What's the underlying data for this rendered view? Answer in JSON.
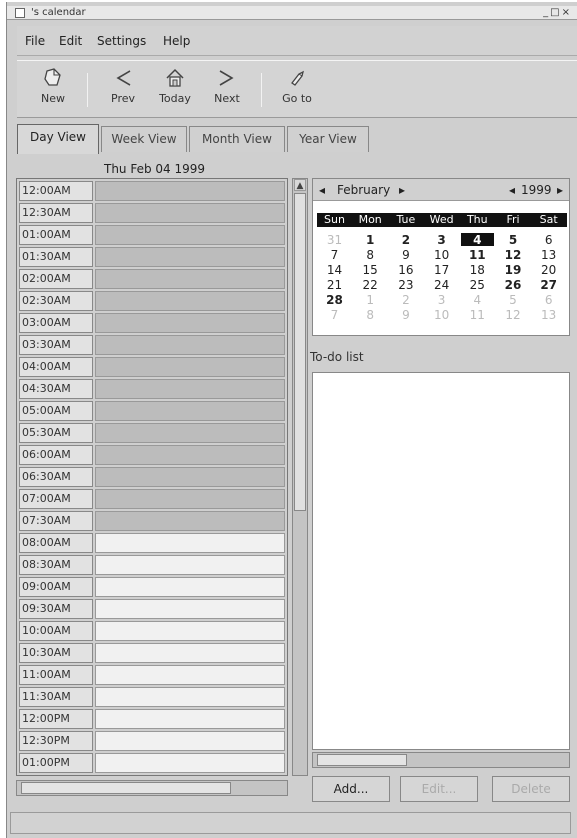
{
  "window": {
    "title": "'s calendar",
    "controls": "_□×"
  },
  "menu": {
    "file": "File",
    "edit": "Edit",
    "settings": "Settings",
    "help": "Help"
  },
  "toolbar": {
    "new": "New",
    "prev": "Prev",
    "today": "Today",
    "next": "Next",
    "goto": "Go to"
  },
  "tabs": {
    "day": "Day View",
    "week": "Week View",
    "month": "Month View",
    "year": "Year View",
    "active": "day"
  },
  "day_view": {
    "date": "Thu Feb 04 1999",
    "rows": [
      {
        "time": "12:00AM",
        "work": false
      },
      {
        "time": "12:30AM",
        "work": false
      },
      {
        "time": "01:00AM",
        "work": false
      },
      {
        "time": "01:30AM",
        "work": false
      },
      {
        "time": "02:00AM",
        "work": false
      },
      {
        "time": "02:30AM",
        "work": false
      },
      {
        "time": "03:00AM",
        "work": false
      },
      {
        "time": "03:30AM",
        "work": false
      },
      {
        "time": "04:00AM",
        "work": false
      },
      {
        "time": "04:30AM",
        "work": false
      },
      {
        "time": "05:00AM",
        "work": false
      },
      {
        "time": "05:30AM",
        "work": false
      },
      {
        "time": "06:00AM",
        "work": false
      },
      {
        "time": "06:30AM",
        "work": false
      },
      {
        "time": "07:00AM",
        "work": false
      },
      {
        "time": "07:30AM",
        "work": false
      },
      {
        "time": "08:00AM",
        "work": true
      },
      {
        "time": "08:30AM",
        "work": true
      },
      {
        "time": "09:00AM",
        "work": true
      },
      {
        "time": "09:30AM",
        "work": true
      },
      {
        "time": "10:00AM",
        "work": true
      },
      {
        "time": "10:30AM",
        "work": true
      },
      {
        "time": "11:00AM",
        "work": true
      },
      {
        "time": "11:30AM",
        "work": true
      },
      {
        "time": "12:00PM",
        "work": true
      },
      {
        "time": "12:30PM",
        "work": true
      },
      {
        "time": "01:00PM",
        "work": true
      }
    ]
  },
  "mini_calendar": {
    "month": "February",
    "year": "1999",
    "prev_arrow": "◂",
    "next_arrow": "▸",
    "weekdays": [
      "Sun",
      "Mon",
      "Tue",
      "Wed",
      "Thu",
      "Fri",
      "Sat"
    ],
    "weeks": [
      [
        {
          "d": "31",
          "dim": true
        },
        {
          "d": "1",
          "bold": true
        },
        {
          "d": "2",
          "bold": true
        },
        {
          "d": "3",
          "bold": true
        },
        {
          "d": "4",
          "sel": true
        },
        {
          "d": "5",
          "bold": true
        },
        {
          "d": "6"
        }
      ],
      [
        {
          "d": "7"
        },
        {
          "d": "8"
        },
        {
          "d": "9"
        },
        {
          "d": "10"
        },
        {
          "d": "11",
          "bold": true
        },
        {
          "d": "12",
          "bold": true
        },
        {
          "d": "13"
        }
      ],
      [
        {
          "d": "14"
        },
        {
          "d": "15"
        },
        {
          "d": "16"
        },
        {
          "d": "17"
        },
        {
          "d": "18"
        },
        {
          "d": "19",
          "bold": true
        },
        {
          "d": "20"
        }
      ],
      [
        {
          "d": "21"
        },
        {
          "d": "22"
        },
        {
          "d": "23"
        },
        {
          "d": "24"
        },
        {
          "d": "25"
        },
        {
          "d": "26",
          "bold": true
        },
        {
          "d": "27",
          "bold": true
        }
      ],
      [
        {
          "d": "28",
          "bold": true
        },
        {
          "d": "1",
          "dim": true
        },
        {
          "d": "2",
          "dim": true
        },
        {
          "d": "3",
          "dim": true
        },
        {
          "d": "4",
          "dim": true
        },
        {
          "d": "5",
          "dim": true
        },
        {
          "d": "6",
          "dim": true
        }
      ],
      [
        {
          "d": "7",
          "dim": true
        },
        {
          "d": "8",
          "dim": true
        },
        {
          "d": "9",
          "dim": true
        },
        {
          "d": "10",
          "dim": true
        },
        {
          "d": "11",
          "dim": true
        },
        {
          "d": "12",
          "dim": true
        },
        {
          "d": "13",
          "dim": true
        }
      ]
    ]
  },
  "todo": {
    "label": "To-do list",
    "items": []
  },
  "buttons": {
    "add": "Add...",
    "edit": "Edit...",
    "delete": "Delete"
  },
  "colors": {
    "off_hours": "#bcbcbc",
    "work_hours": "#f1f1f1",
    "selected_day": "#111111"
  }
}
